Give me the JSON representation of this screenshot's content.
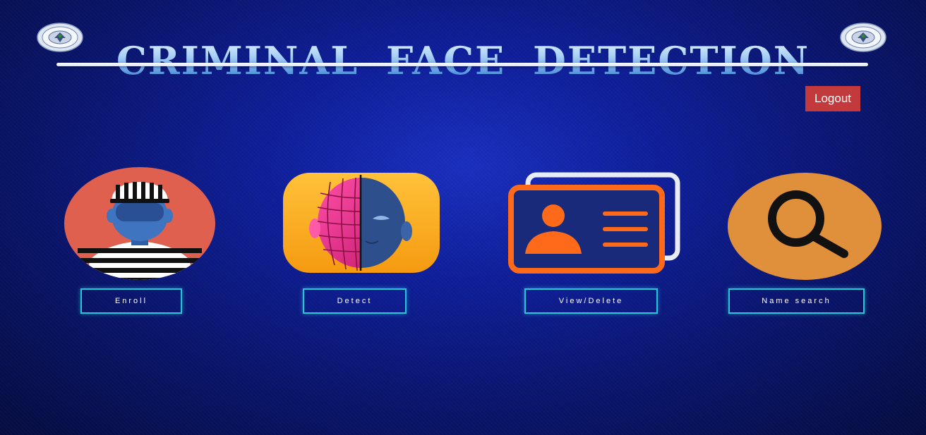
{
  "header": {
    "title": "CRIMINAL FACE DETECTION",
    "left_emblem_icon": "agency-seal-icon",
    "right_emblem_icon": "agency-seal-icon"
  },
  "toolbar": {
    "logout_label": "Logout"
  },
  "actions": [
    {
      "label": "Enroll",
      "icon": "prisoner-icon"
    },
    {
      "label": "Detect",
      "icon": "face-scan-icon"
    },
    {
      "label": "View/Delete",
      "icon": "id-card-icon"
    },
    {
      "label": "Name search",
      "icon": "magnifier-icon"
    }
  ],
  "colors": {
    "background": "#0f1f9a",
    "title_gradient_top": "#e6f3ff",
    "title_gradient_bottom": "#3c7fcf",
    "logout_bg": "#c23a3c",
    "button_border": "#26c6da"
  }
}
